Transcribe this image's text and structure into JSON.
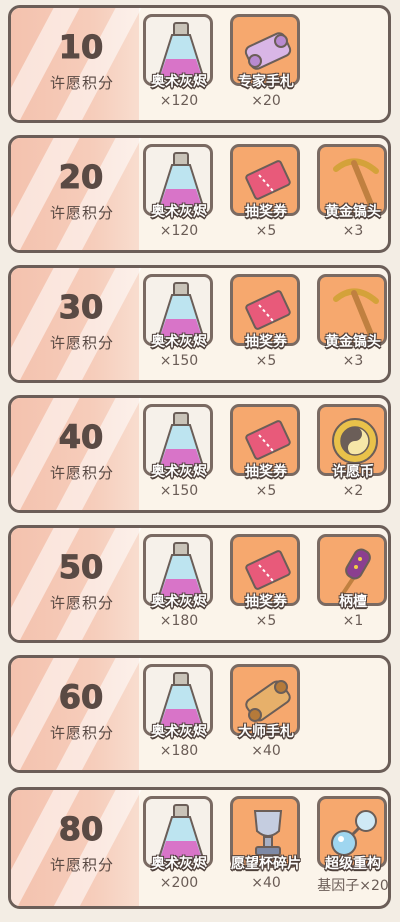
{
  "points_label": "许愿积分",
  "tiers": [
    {
      "score": "10",
      "rewards": [
        {
          "name": "奥术灰烬",
          "qty": "×120",
          "icon": "potion-flask-icon"
        },
        {
          "name": "专家手札",
          "qty": "×20",
          "icon": "scroll-icon"
        }
      ]
    },
    {
      "score": "20",
      "rewards": [
        {
          "name": "奥术灰烬",
          "qty": "×120",
          "icon": "potion-flask-icon"
        },
        {
          "name": "抽奖券",
          "qty": "×5",
          "icon": "ticket-icon"
        },
        {
          "name": "黄金镐头",
          "qty": "×3",
          "icon": "pickaxe-icon"
        }
      ]
    },
    {
      "score": "30",
      "rewards": [
        {
          "name": "奥术灰烬",
          "qty": "×150",
          "icon": "potion-flask-icon"
        },
        {
          "name": "抽奖券",
          "qty": "×5",
          "icon": "ticket-icon"
        },
        {
          "name": "黄金镐头",
          "qty": "×3",
          "icon": "pickaxe-icon"
        }
      ]
    },
    {
      "score": "40",
      "rewards": [
        {
          "name": "奥术灰烬",
          "qty": "×150",
          "icon": "potion-flask-icon"
        },
        {
          "name": "抽奖券",
          "qty": "×5",
          "icon": "ticket-icon"
        },
        {
          "name": "许愿币",
          "qty": "×2",
          "icon": "coin-icon"
        }
      ]
    },
    {
      "score": "50",
      "rewards": [
        {
          "name": "奥术灰烬",
          "qty": "×180",
          "icon": "potion-flask-icon"
        },
        {
          "name": "抽奖券",
          "qty": "×5",
          "icon": "ticket-icon"
        },
        {
          "name": "柄檀",
          "qty": "×1",
          "icon": "firework-stick-icon"
        }
      ]
    },
    {
      "score": "60",
      "rewards": [
        {
          "name": "奥术灰烬",
          "qty": "×180",
          "icon": "potion-flask-icon"
        },
        {
          "name": "大师手札",
          "qty": "×40",
          "icon": "scroll-icon"
        }
      ]
    },
    {
      "score": "80",
      "rewards": [
        {
          "name": "奥术灰烬",
          "qty": "×200",
          "icon": "potion-flask-icon"
        },
        {
          "name": "愿望杯碎片",
          "qty": "×40",
          "icon": "trophy-fragment-icon"
        },
        {
          "name": "超级重构",
          "qty": "基因子×20",
          "icon": "gene-orb-icon"
        }
      ]
    }
  ]
}
